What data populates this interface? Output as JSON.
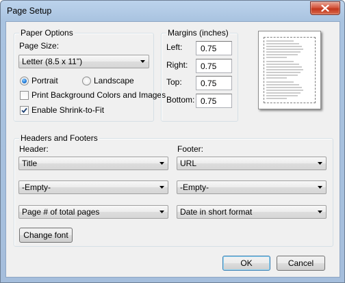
{
  "window": {
    "title": "Page Setup"
  },
  "paper_options": {
    "group_title": "Paper Options",
    "page_size_label": "Page Size:",
    "page_size_value": "Letter (8.5 x 11\")",
    "portrait_label": "Portrait",
    "landscape_label": "Landscape",
    "orientation_selected": "Portrait",
    "print_bg_label": "Print Background Colors and Images",
    "print_bg_checked": false,
    "shrink_label": "Enable Shrink-to-Fit",
    "shrink_checked": true
  },
  "margins": {
    "group_title": "Margins (inches)",
    "left_label": "Left:",
    "left_value": "0.75",
    "right_label": "Right:",
    "right_value": "0.75",
    "top_label": "Top:",
    "top_value": "0.75",
    "bottom_label": "Bottom:",
    "bottom_value": "0.75"
  },
  "headers_footers": {
    "group_title": "Headers and Footers",
    "header_label": "Header:",
    "footer_label": "Footer:",
    "header_values": [
      "Title",
      "-Empty-",
      "Page # of total pages"
    ],
    "footer_values": [
      "URL",
      "-Empty-",
      "Date in short format"
    ],
    "change_font_label": "Change font"
  },
  "buttons": {
    "ok_label": "OK",
    "cancel_label": "Cancel"
  },
  "icons": {
    "close": "close-icon",
    "dropdown": "chevron-down-icon",
    "checkmark": "checkmark-icon"
  },
  "colors": {
    "title_bar": "#bcd3ec",
    "close_button": "#c2361c",
    "dialog_bg": "#f0f0f0",
    "radio_dot": "#1f77d6",
    "default_button_border": "#3c7fb1"
  }
}
